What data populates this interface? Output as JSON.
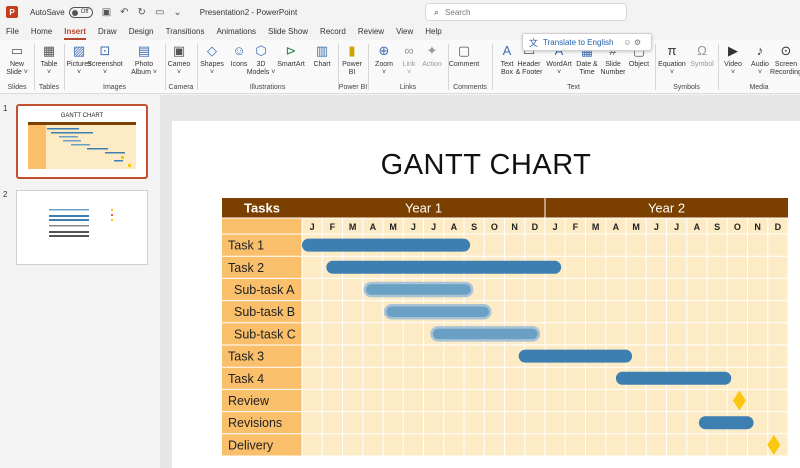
{
  "titlebar": {
    "logo": "P",
    "autosave_label": "AutoSave",
    "autosave_state": "Off",
    "document_title": "Presentation2  -  PowerPoint",
    "search_placeholder": "Search"
  },
  "tabs": [
    "File",
    "Home",
    "Insert",
    "Draw",
    "Design",
    "Transitions",
    "Animations",
    "Slide Show",
    "Record",
    "Review",
    "View",
    "Help"
  ],
  "active_tab": "Insert",
  "ribbon": {
    "buttons": [
      {
        "label": "New\nSlide ˅",
        "icon": "new-slide-icon",
        "glyph": "▭"
      },
      {
        "label": "Table\n˅",
        "icon": "table-icon",
        "glyph": "▦"
      },
      {
        "label": "Pictures\n˅",
        "icon": "pictures-icon",
        "glyph": "▨"
      },
      {
        "label": "Screenshot\n˅",
        "icon": "screenshot-icon",
        "glyph": "⊡"
      },
      {
        "label": "Photo\nAlbum ˅",
        "icon": "photo-album-icon",
        "glyph": "▤"
      },
      {
        "label": "Cameo\n˅",
        "icon": "cameo-icon",
        "glyph": "▣"
      },
      {
        "label": "Shapes\n˅",
        "icon": "shapes-icon",
        "glyph": "◇"
      },
      {
        "label": "Icons",
        "icon": "icons-icon",
        "glyph": "☺"
      },
      {
        "label": "3D\nModels ˅",
        "icon": "3d-models-icon",
        "glyph": "⬡"
      },
      {
        "label": "SmartArt",
        "icon": "smartart-icon",
        "glyph": "⊳"
      },
      {
        "label": "Chart",
        "icon": "chart-icon",
        "glyph": "▥"
      },
      {
        "label": "Power\nBI",
        "icon": "power-bi-icon",
        "glyph": "▮"
      },
      {
        "label": "Zoom\n˅",
        "icon": "zoom-icon",
        "glyph": "⊕"
      },
      {
        "label": "Link\n˅",
        "icon": "link-icon",
        "glyph": "∞"
      },
      {
        "label": "Action",
        "icon": "action-icon",
        "glyph": "✦"
      },
      {
        "label": "Comment",
        "icon": "comment-icon",
        "glyph": "▢"
      },
      {
        "label": "Text\nBox",
        "icon": "text-box-icon",
        "glyph": "A"
      },
      {
        "label": "Header\n& Footer",
        "icon": "header-footer-icon",
        "glyph": "▭"
      },
      {
        "label": "WordArt\n˅",
        "icon": "wordart-icon",
        "glyph": "A"
      },
      {
        "label": "Date &\nTime",
        "icon": "date-time-icon",
        "glyph": "▦"
      },
      {
        "label": "Slide\nNumber",
        "icon": "slide-number-icon",
        "glyph": "#"
      },
      {
        "label": "Object",
        "icon": "object-icon",
        "glyph": "▢"
      },
      {
        "label": "Equation\n˅",
        "icon": "equation-icon",
        "glyph": "π"
      },
      {
        "label": "Symbol",
        "icon": "symbol-icon",
        "glyph": "Ω"
      },
      {
        "label": "Video\n˅",
        "icon": "video-icon",
        "glyph": "▶"
      },
      {
        "label": "Audio\n˅",
        "icon": "audio-icon",
        "glyph": "♪"
      },
      {
        "label": "Screen\nRecording",
        "icon": "screen-recording-icon",
        "glyph": "⊙"
      }
    ],
    "groups": [
      "Slides",
      "Tables",
      "Images",
      "Camera",
      "Illustrations",
      "Power BI",
      "Links",
      "Comments",
      "Text",
      "Symbols",
      "Media"
    ],
    "translate_popup": "Translate to English"
  },
  "thumbnails": [
    {
      "number": "1",
      "title": "GANTT CHART"
    },
    {
      "number": "2"
    }
  ],
  "slide": {
    "title": "GANTT CHART"
  },
  "chart_data": {
    "type": "gantt",
    "header_label": "Tasks",
    "years": [
      "Year 1",
      "Year 2"
    ],
    "months": [
      "J",
      "F",
      "M",
      "A",
      "M",
      "J",
      "J",
      "A",
      "S",
      "O",
      "N",
      "D",
      "J",
      "F",
      "M",
      "A",
      "M",
      "J",
      "J",
      "A",
      "S",
      "O",
      "N",
      "D"
    ],
    "tasks": [
      {
        "name": "Task 1",
        "indent": false,
        "kind": "bar",
        "start": 0,
        "end": 8.3
      },
      {
        "name": "Task 2",
        "indent": false,
        "kind": "bar",
        "start": 1.2,
        "end": 12.8
      },
      {
        "name": "Sub-task A",
        "indent": true,
        "kind": "subbar",
        "start": 3.1,
        "end": 8.4
      },
      {
        "name": "Sub-task B",
        "indent": true,
        "kind": "subbar",
        "start": 4.1,
        "end": 9.3
      },
      {
        "name": "Sub-task C",
        "indent": true,
        "kind": "subbar",
        "start": 6.4,
        "end": 11.7
      },
      {
        "name": "Task 3",
        "indent": false,
        "kind": "bar",
        "start": 10.7,
        "end": 16.3
      },
      {
        "name": "Task 4",
        "indent": false,
        "kind": "bar",
        "start": 15.5,
        "end": 21.2
      },
      {
        "name": "Review",
        "indent": false,
        "kind": "milestone",
        "at": 21.6
      },
      {
        "name": "Revisions",
        "indent": false,
        "kind": "bar",
        "start": 19.6,
        "end": 22.3
      },
      {
        "name": "Delivery",
        "indent": false,
        "kind": "milestone",
        "at": 23.3
      }
    ],
    "colors": {
      "header": "#7b3f00",
      "task_label_bg": "#f9bf6b",
      "grid_bg": "#fdebc6",
      "bar": "#3c7fb0",
      "subbar": "#6aa0c4",
      "milestone": "#fbc70e"
    }
  }
}
